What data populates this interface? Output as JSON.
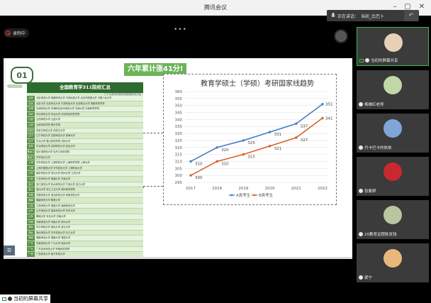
{
  "window": {
    "title": "腾讯会议"
  },
  "controls": {
    "recording": "录制中",
    "speaking_label": "正在讲话：",
    "speaking_name": "当初_比巴卜"
  },
  "slide": {
    "badge": "01",
    "headline": "六年累计涨41分!",
    "table": {
      "title": "全国教育学311院校汇总",
      "subtitle": "三个大类排列顺序按照国家线分组",
      "rows": [
        {
          "region": "北京",
          "schools": "北京师范大学  首都师范大学  中央民族大学  北京外国语大学  中国人民大学"
        },
        {
          "region": "北京",
          "schools": "北京大学  北京林业大学  中央财经大学  北京联合大学  首都体育学院"
        },
        {
          "region": "天津",
          "schools": "天津师范大学  天津职业技术师范大学  天津大学  天津体育学院"
        },
        {
          "region": "河北",
          "schools": "河北师范大学  河北大学  河北科技师范学院"
        },
        {
          "region": "山西",
          "schools": "山西师范大学  山西大学"
        },
        {
          "region": "山西",
          "schools": "太原师范学院  晋中学院"
        },
        {
          "region": "内蒙古",
          "schools": "内蒙古师范大学  内蒙古大学"
        },
        {
          "region": "辽宁",
          "schools": "辽宁师范大学  沈阳师范大学  渤海大学"
        },
        {
          "region": "辽宁",
          "schools": "东北大学  鞍山师范学院  沈阳大学"
        },
        {
          "region": "吉林",
          "schools": "东北师范大学  吉林师范大学  延边大学"
        },
        {
          "region": "黑龙江",
          "schools": "哈尔滨师范大学  牡丹江师范学院"
        },
        {
          "region": "黑龙江",
          "schools": "齐齐哈尔大学"
        },
        {
          "region": "上海",
          "schools": "华东师范大学  上海师范大学  上海体育学院  上海大学"
        },
        {
          "region": "上海",
          "schools": "上海外国语大学  华东政法大学  上海财经大学"
        },
        {
          "region": "江苏",
          "schools": "南京师范大学  苏州大学  扬州大学  江苏大学"
        },
        {
          "region": "江苏",
          "schools": "江苏师范大学  南通大学  东南大学"
        },
        {
          "region": "浙江",
          "schools": "浙江师范大学  杭州师范大学  宁波大学  浙江大学"
        },
        {
          "region": "浙江",
          "schools": "温州大学  浙江工业大学  湖州师范学院"
        },
        {
          "region": "安徽",
          "schools": "安徽师范大学  淮北师范大学  阜阳师范大学"
        },
        {
          "region": "福建",
          "schools": "福建师范大学  集美大学"
        },
        {
          "region": "江西",
          "schools": "江西师范大学  南昌大学  赣南师范大学"
        },
        {
          "region": "山东",
          "schools": "山东师范大学  曲阜师范大学  鲁东大学"
        },
        {
          "region": "山东",
          "schools": "聊城大学  青岛大学  济南大学"
        },
        {
          "region": "河南",
          "schools": "河南师范大学  河南大学  郑州大学"
        },
        {
          "region": "湖北",
          "schools": "华中师范大学  湖北大学  武汉大学"
        },
        {
          "region": "湖北",
          "schools": "湖北师范大学  华中科技大学  长江大学"
        },
        {
          "region": "湖南",
          "schools": "湖南师范大学  湖南大学  湘潭大学"
        },
        {
          "region": "广东",
          "schools": "华南师范大学  广州大学  深圳大学"
        },
        {
          "region": "广东",
          "schools": "广东技术师范大学  岭南师范学院"
        },
        {
          "region": "广西",
          "schools": "广西师范大学  南宁师范大学"
        },
        {
          "region": "海南",
          "schools": "海南师范大学"
        },
        {
          "region": "重庆",
          "schools": "西南大学  重庆师范大学  四川外国语大学"
        },
        {
          "region": "四川",
          "schools": "四川师范大学  西华师范大学  四川大学"
        },
        {
          "region": "贵州",
          "schools": "贵州师范大学  贵州大学"
        },
        {
          "region": "云南",
          "schools": "云南师范大学  云南大学"
        },
        {
          "region": "陕西",
          "schools": "陕西师范大学  西北大学"
        },
        {
          "region": "甘肃",
          "schools": "西北师范大学  兰州大学"
        },
        {
          "region": "新疆",
          "schools": "新疆师范大学  石河子大学  伊犁师范大学"
        },
        {
          "region": "宁夏",
          "schools": "宁夏大学"
        },
        {
          "region": "青海",
          "schools": "青海师范大学"
        },
        {
          "region": "西藏",
          "schools": "西藏大学"
        }
      ]
    }
  },
  "chart_data": {
    "type": "line",
    "title": "教育学硕士（学硕）考研国家线趋势",
    "x": [
      "2017",
      "2018",
      "2019",
      "2020",
      "2021",
      "2022"
    ],
    "ylim": [
      295,
      360
    ],
    "yticks": [
      295,
      300,
      305,
      310,
      315,
      320,
      325,
      330,
      335,
      340,
      345,
      350,
      355,
      360
    ],
    "series": [
      {
        "name": "A类考生",
        "color": "#4a7cc9",
        "values": [
          310,
          320,
          325,
          331,
          337,
          351
        ]
      },
      {
        "name": "B类考生",
        "color": "#d9602b",
        "values": [
          300,
          310,
          315,
          321,
          327,
          341
        ]
      }
    ],
    "grid": true,
    "legend": "bottom"
  },
  "participants": [
    {
      "name": "当初的屏幕共享",
      "avatar_color": "#e8d0b8",
      "sharing": true
    },
    {
      "name": "杨婵红老师",
      "avatar_color": "#c0d8a8",
      "sharing": false
    },
    {
      "name": "丹卡巴卡的依依",
      "avatar_color": "#7fa6d8",
      "sharing": false
    },
    {
      "name": "张紫婷",
      "avatar_color": "#c8282f",
      "sharing": false
    },
    {
      "name": "20教育远程陈发钱",
      "avatar_color": "#b9c4a0",
      "sharing": false
    },
    {
      "name": "梁宁",
      "avatar_color": "#e7b87a",
      "sharing": false
    }
  ],
  "status": {
    "share_label": "当初的屏幕共享"
  }
}
